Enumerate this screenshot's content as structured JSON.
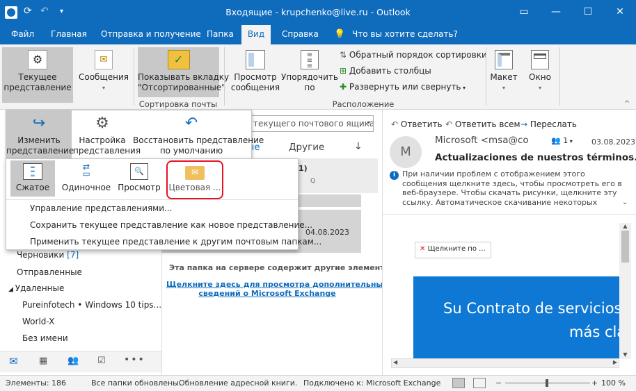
{
  "window": {
    "title": "Входящие - krupchenko@live.ru - Outlook"
  },
  "tabs": [
    "Файл",
    "Главная",
    "Отправка и получение",
    "Папка",
    "Вид",
    "Справка",
    "Что вы хотите сделать?"
  ],
  "ribbon": {
    "current_view": "Текущее\nпредставление",
    "messages": "Сообщения",
    "show_sorted": "Показывать вкладку\n\"Отсортированные\"",
    "group_sort": "Сортировка почты",
    "view_mail": "Просмотр\nсообщения",
    "order_by": "Упорядочить\nпо",
    "reverse_sort": "Обратный порядок сортировки",
    "add_columns": "Добавить столбцы",
    "expand_collapse": "Развернуть или свернуть",
    "group_arrange": "Расположение",
    "layout": "Макет",
    "window": "Окно"
  },
  "view_menu": {
    "change_view": "Изменить\nпредставление",
    "view_settings": "Настройка\nпредставления",
    "reset_view": "Восстановить представление\nпо умолчанию"
  },
  "change_view_menu": {
    "options": [
      "Сжатое",
      "Одиночное",
      "Просмотр",
      "Цветовая ..."
    ],
    "items": [
      "Управление представлениями...",
      "Сохранить текущее представление как новое представление...",
      "Применить текущее представление к другим почтовым папкам..."
    ]
  },
  "folders": {
    "drafts": "Черновики",
    "drafts_count": "[7]",
    "sent": "Отправленные",
    "deleted": "Удаленные",
    "sub": [
      "Pureinfotech • Windows 10 tips...",
      "World-X",
      "Без имени"
    ]
  },
  "list": {
    "search_placeholder": "текущего почтового ящика",
    "tab_unread": "нные",
    "tab_other": "Другие",
    "date_header": "1)",
    "mail_date": "04.08.2023",
    "server_note": "Эта папка на сервере содержит другие элементы.",
    "exchange_link": "Щелкните здесь для просмотра дополнительных\nсведений о Microsoft Exchange"
  },
  "reading": {
    "reply": "Ответить",
    "reply_all": "Ответить всем",
    "forward": "Переслать",
    "avatar": "M",
    "from": "Microsoft <msa@co",
    "people_count": "1",
    "date": "03.08.2023",
    "subject": "Actualizaciones de nuestros términos...",
    "info": "При наличии проблем с отображением этого сообщения щелкните здесь, чтобы просмотреть его в веб-браузере. Чтобы скачать рисунки, щелкните эту ссылку. Автоматическое скачивание некоторых рисунков в",
    "img_placeholder": "Щелкните по ...",
    "banner_line1": "Su Contrato de servicios",
    "banner_line2": "más cla"
  },
  "status": {
    "items": "Элементы: 186",
    "updated": "Все папки обновлены.",
    "address_book": "Обновление адресной книги.",
    "connected": "Подключено к: Microsoft Exchange",
    "zoom": "100 %"
  },
  "colors": {
    "accent": "#0f6cbd",
    "highlight": "#e81123",
    "banner": "#0f78d4"
  }
}
